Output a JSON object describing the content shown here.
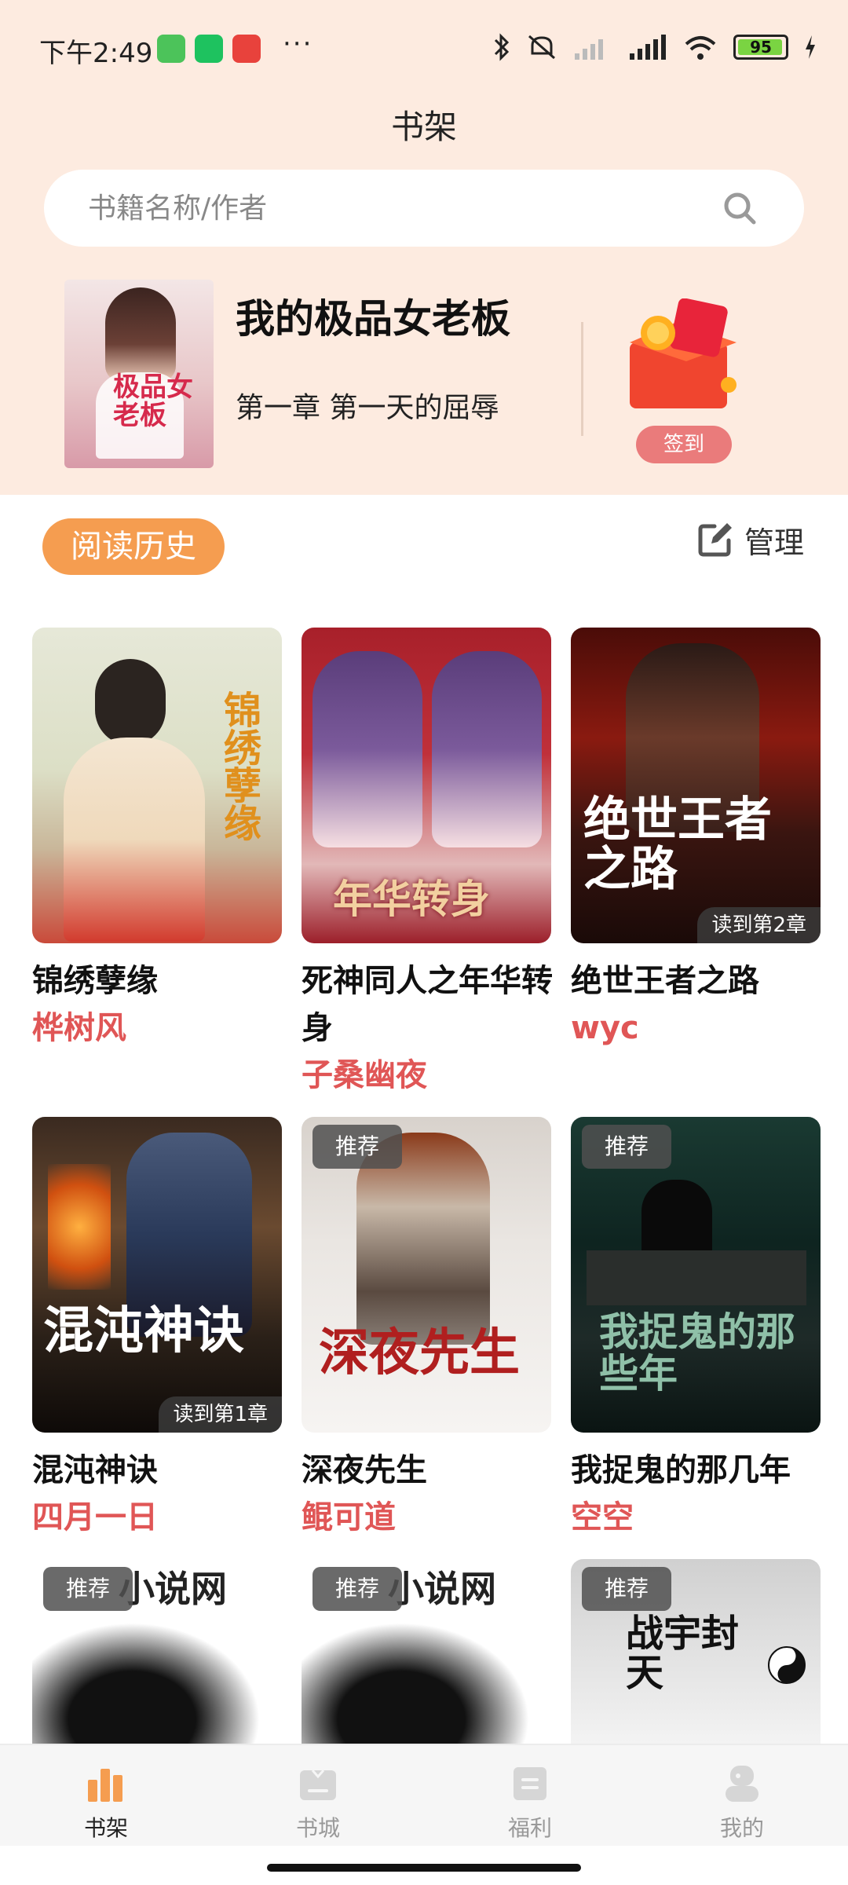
{
  "status_bar": {
    "time": "下午2:49",
    "dots": "···",
    "battery": "95"
  },
  "header": {
    "title": "书架"
  },
  "search": {
    "placeholder": "书籍名称/作者"
  },
  "current_book": {
    "title": "我的极品女老板",
    "chapter": "第一章 第一天的屈辱",
    "cover_text": "极品女老板",
    "sign_label": "签到"
  },
  "section": {
    "history_label": "阅读历史",
    "manage_label": "管理"
  },
  "books": [
    {
      "title": "锦绣孽缘",
      "author": "桦树风",
      "cover_text": "锦绣孽缘",
      "badge": "",
      "progress": ""
    },
    {
      "title": "死神同人之年华转身",
      "author": "子桑幽夜",
      "cover_text": "年华转身",
      "badge": "",
      "progress": ""
    },
    {
      "title": "绝世王者之路",
      "author": "wyc",
      "cover_text": "绝世王者之路",
      "badge": "",
      "progress": "读到第2章"
    },
    {
      "title": "混沌神诀",
      "author": "四月一日",
      "cover_text": "混沌神诀",
      "badge": "",
      "progress": "读到第1章"
    },
    {
      "title": "深夜先生",
      "author": "鲲可道",
      "cover_text": "深夜先生",
      "badge": "推荐",
      "progress": ""
    },
    {
      "title": "我捉鬼的那几年",
      "author": "空空",
      "cover_text": "我捉鬼的那些年",
      "badge": "推荐",
      "progress": ""
    },
    {
      "title": "",
      "author": "",
      "cover_text": "小说网",
      "badge": "推荐",
      "progress": ""
    },
    {
      "title": "",
      "author": "",
      "cover_text": "小说网",
      "badge": "推荐",
      "progress": ""
    },
    {
      "title": "",
      "author": "",
      "cover_text": "战宇封天",
      "badge": "推荐",
      "progress": ""
    }
  ],
  "nav": {
    "items": [
      {
        "label": "书架",
        "icon": "bookshelf-icon"
      },
      {
        "label": "书城",
        "icon": "store-icon"
      },
      {
        "label": "福利",
        "icon": "welfare-icon"
      },
      {
        "label": "我的",
        "icon": "profile-icon"
      }
    ]
  },
  "colors": {
    "header_bg": "#fdebe0",
    "accent_orange": "#f59d50",
    "author_red": "#e05656",
    "sign_pink": "#ea7b7b"
  }
}
